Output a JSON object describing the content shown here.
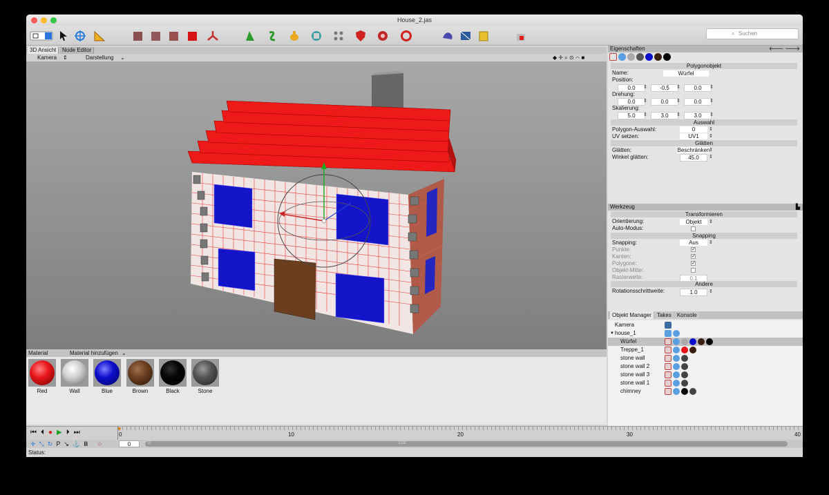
{
  "window": {
    "title": "House_2.jas"
  },
  "search": {
    "placeholder": "Suchen"
  },
  "view_tabs": [
    "3D Ansicht",
    "Node Editor"
  ],
  "viewport_menu": {
    "camera": "Kamera",
    "display": "Darstellung"
  },
  "materials": {
    "header": "Material",
    "add": "Material hinzufügen",
    "items": [
      {
        "name": "Red",
        "color": "#e8161a"
      },
      {
        "name": "Wall",
        "color": "#d0d0d0"
      },
      {
        "name": "Blue",
        "color": "#0d0dcc"
      },
      {
        "name": "Brown",
        "color": "#6b4020"
      },
      {
        "name": "Black",
        "color": "#050505"
      },
      {
        "name": "Stone",
        "color": "#555555"
      }
    ]
  },
  "properties": {
    "header": "Eigenschaften",
    "section_polygon": "Polygonobjekt",
    "name_label": "Name:",
    "name_value": "Würfel",
    "position_label": "Position:",
    "position": [
      "0.0",
      "-0.5",
      "0.0"
    ],
    "rotation_label": "Drehung:",
    "rotation": [
      "0.0",
      "0.0",
      "0.0"
    ],
    "scale_label": "Skalierung:",
    "scale": [
      "5.0",
      "3.0",
      "3.0"
    ],
    "section_selection": "Auswahl",
    "poly_sel_label": "Polygon-Auswahl:",
    "poly_sel_value": "0",
    "uv_label": "UV setzen:",
    "uv_value": "UV1",
    "section_smooth": "Glätten",
    "smooth_label": "Glätten:",
    "smooth_value": "Beschränken",
    "angle_label": "Winkel glätten:",
    "angle_value": "45.0"
  },
  "tool": {
    "header": "Werkzeug",
    "section_transform": "Transformieren",
    "orient_label": "Orientierung:",
    "orient_value": "Objekt",
    "auto_label": "Auto-Modus:",
    "section_snapping": "Snapping",
    "snapping_label": "Snapping:",
    "snapping_value": "Aus",
    "points": "Punkte:",
    "edges": "Kanten:",
    "polygons": "Polygone:",
    "center": "Objekt-Mitte:",
    "grid": "Rasterweite:",
    "grid_value": "0.1",
    "section_other": "Andere",
    "rot_step_label": "Rotationsschrittweite:",
    "rot_step_value": "1.0"
  },
  "object_manager": {
    "tabs": [
      "Objekt Manager",
      "Takes",
      "Konsole"
    ],
    "objects": [
      "Kamera",
      "house_1",
      "Würfel",
      "Treppe_1",
      "stone wall",
      "stone wall 2",
      "stone wall 3",
      "stone wall 1",
      "chimney"
    ]
  },
  "timeline": {
    "ticks": [
      "0",
      "10",
      "20",
      "30",
      "40"
    ],
    "frame": "0",
    "range_start": "0",
    "range_end": "120"
  },
  "status": {
    "label": "Status:"
  }
}
